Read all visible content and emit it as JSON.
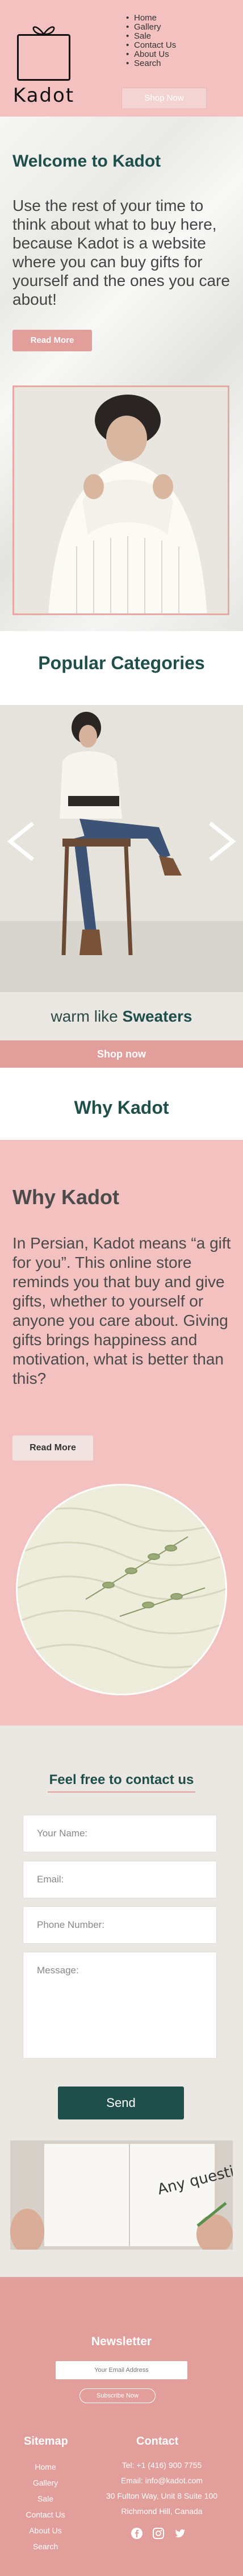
{
  "header": {
    "logo_text": "Kadot",
    "nav": [
      "Home",
      "Gallery",
      "Sale",
      "Contact Us",
      "About Us",
      "Search"
    ],
    "shop_now": "Shop Now"
  },
  "welcome": {
    "title": "Welcome to Kadot",
    "text": "Use the rest of your time to think about what to buy here, because Kadot is a website where you can buy gifts for yourself and the ones you care about!",
    "read_more": "Read More"
  },
  "popular": {
    "title": "Popular Categories",
    "caption_prefix": "warm like ",
    "caption_bold": "Sweaters",
    "shop_now": "Shop now"
  },
  "why": {
    "heading": "Why Kadot",
    "title": "Why Kadot",
    "text": "In Persian, Kadot means “a gift for you”. This online store reminds you that buy and give gifts, whether to yourself or anyone you care about. Giving gifts brings happiness and motivation, what is better than this?",
    "read_more": "Read More"
  },
  "contact": {
    "title": "Feel free to contact us",
    "name_placeholder": "Your Name:",
    "email_placeholder": "Email:",
    "phone_placeholder": "Phone Number:",
    "message_placeholder": "Message:",
    "send": "Send",
    "note_text": "Any question?"
  },
  "footer": {
    "newsletter_title": "Newsletter",
    "email_placeholder": "Your Email Address",
    "subscribe": "Subscribe Now",
    "sitemap_title": "Sitemap",
    "sitemap": [
      "Home",
      "Gallery",
      "Sale",
      "Contact Us",
      "About Us",
      "Search"
    ],
    "contact_title": "Contact",
    "contact_lines": [
      "Tel: +1 (416) 900 7755",
      "Email: info@kadot.com",
      "30 Fulton Way, Unit 8 Suite 100",
      "Richmond Hill, Canada"
    ],
    "socials": [
      "facebook-icon",
      "instagram-icon",
      "twitter-icon"
    ]
  },
  "colors": {
    "pink": "#f2c1c0",
    "accent": "#e29e9b",
    "teal": "#1f4f4a"
  }
}
